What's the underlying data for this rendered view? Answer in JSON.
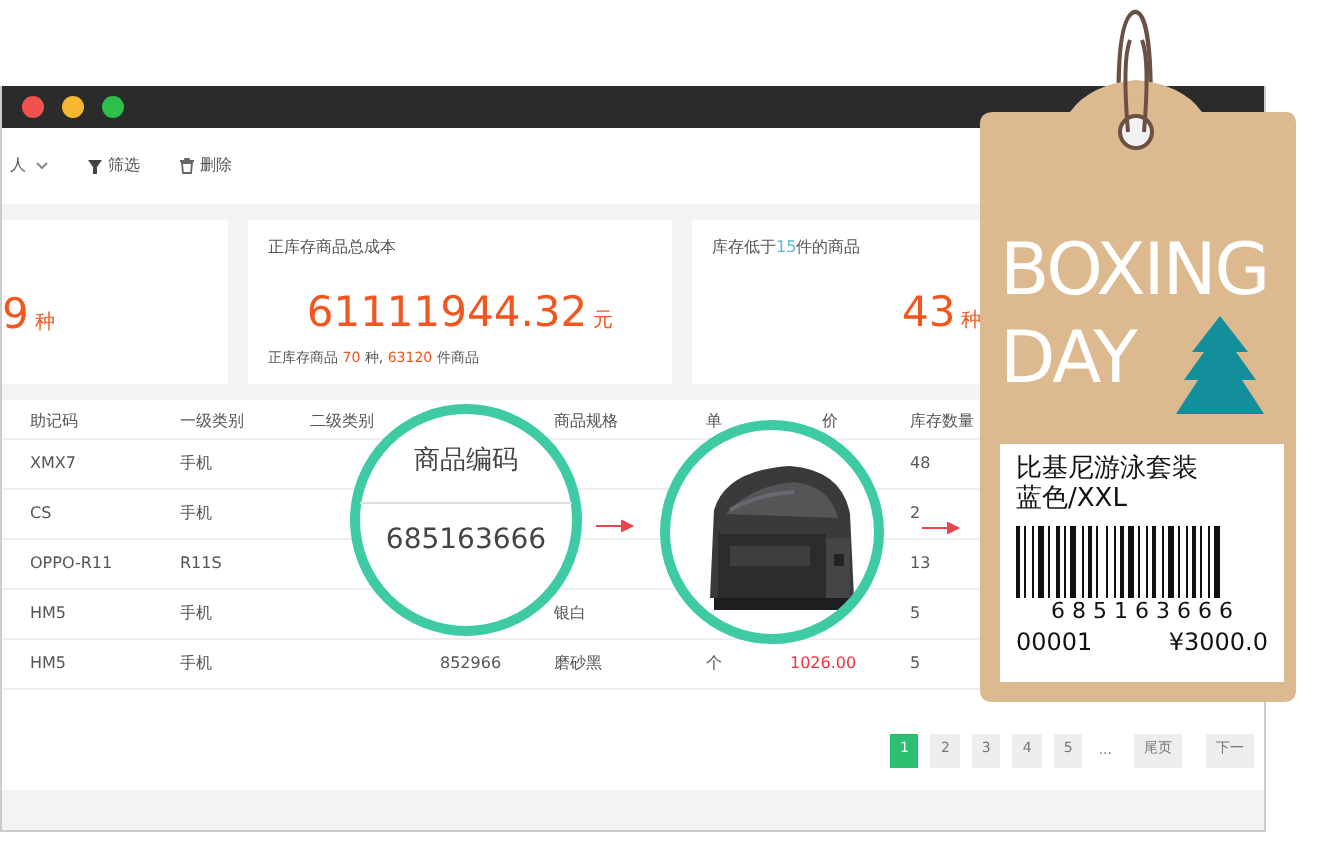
{
  "window": {
    "traffic_lights": [
      {
        "color": "#f0524f"
      },
      {
        "color": "#f7b731"
      },
      {
        "color": "#2dbf4a"
      }
    ]
  },
  "toolbar": [
    {
      "kind": "dropdown",
      "label": "人"
    },
    {
      "kind": "filter",
      "label": "筛选"
    },
    {
      "kind": "delete",
      "label": "删除"
    }
  ],
  "stats": [
    {
      "value": "9",
      "unit": "种"
    },
    {
      "title": [
        {
          "text": "正库存商品总成本"
        }
      ],
      "value": "61111944.32",
      "unit": "元",
      "footer": [
        {
          "text": "正库存商品 "
        },
        {
          "text": "70",
          "accent": true
        },
        {
          "text": " 种, "
        },
        {
          "text": "63120",
          "accent": true
        },
        {
          "text": " 件商品"
        }
      ]
    },
    {
      "title": [
        {
          "text": "库存低于"
        },
        {
          "text": "15",
          "accent": true
        },
        {
          "text": "件的商品"
        }
      ],
      "value": "43",
      "unit": "种"
    }
  ],
  "table": {
    "columns": [
      "助记码",
      "一级类别",
      "二级类别",
      null,
      "商品规格",
      "单",
      "价",
      "库存数量"
    ],
    "rows": [
      {
        "cells": [
          "XMX7",
          "手机",
          null,
          null,
          null,
          null,
          null,
          "48"
        ]
      },
      {
        "cells": [
          "CS",
          "手机",
          null,
          null,
          null,
          null,
          null,
          "2"
        ]
      },
      {
        "cells": [
          "OPPO-R11",
          "R11S",
          null,
          null,
          null,
          null,
          null,
          "13"
        ]
      },
      {
        "cells": [
          "HM5",
          "手机",
          null,
          null,
          "银白",
          null,
          null,
          "5"
        ]
      },
      {
        "cells": [
          "HM5",
          "手机",
          null,
          "852966",
          "磨砂黑",
          "个",
          {
            "text": "1026.00",
            "alert": true
          },
          "5"
        ]
      }
    ]
  },
  "pagination": [
    {
      "kind": "page",
      "label": "1",
      "selected": true
    },
    {
      "kind": "page",
      "label": "2",
      "selected": false
    },
    {
      "kind": "page",
      "label": "3",
      "selected": false
    },
    {
      "kind": "page",
      "label": "4",
      "selected": false
    },
    {
      "kind": "page",
      "label": "5",
      "selected": false
    },
    {
      "kind": "ellipsis",
      "label": "..."
    },
    {
      "kind": "link",
      "label": "尾页"
    },
    {
      "kind": "link",
      "label": "下一"
    }
  ],
  "code_callout": {
    "title": "商品编码",
    "value": "685163666"
  },
  "tag": {
    "title_lines": [
      "BOXING",
      "DAY"
    ],
    "label": {
      "lines": [
        "比基尼游泳套装",
        "蓝色/XXL"
      ],
      "barcode_digits": "6 8 5 1 6 3 6 6 6",
      "serial": "00001",
      "price": "¥3000.0"
    }
  }
}
